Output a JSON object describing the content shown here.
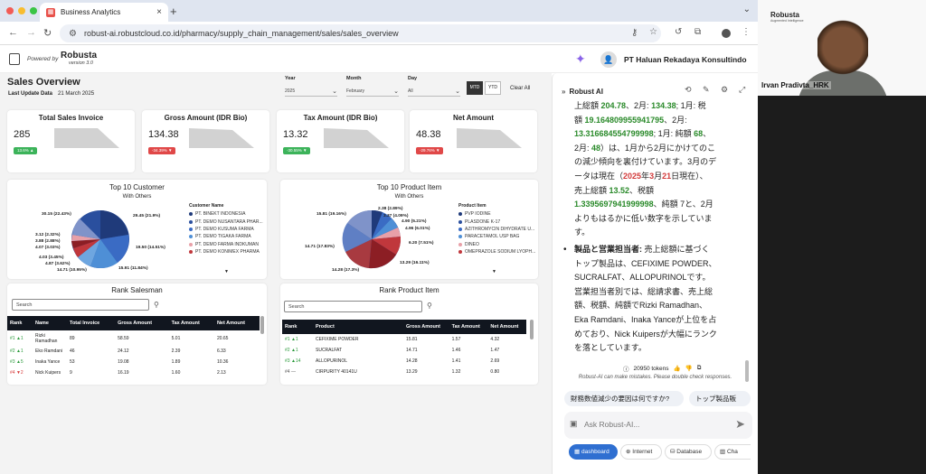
{
  "browser": {
    "tab_title": "Business Analytics",
    "url": "robust-ai.robustcloud.co.id/pharmacy/supply_chain_management/sales/sales_overview"
  },
  "header": {
    "powered_by": "Powered by",
    "logo": "Robusta",
    "version": "version 3.0",
    "company": "PT Haluan Rekadaya Konsultindo"
  },
  "page": {
    "title": "Sales Overview",
    "update_label": "Last Update Data",
    "update_value": "21 March 2025"
  },
  "filters": {
    "year_label": "Year",
    "year_value": "2025",
    "month_label": "Month",
    "month_value": "February",
    "day_label": "Day",
    "day_value": "All",
    "mtd": "MTD",
    "ytd": "YTD",
    "clear": "Clear All"
  },
  "kpis": [
    {
      "title": "Total Sales Invoice",
      "value": "285",
      "badge": "13.6% ▲",
      "badge_color": "#3cb35a"
    },
    {
      "title": "Gross Amount (IDR Bio)",
      "value": "134.38",
      "badge": "-34.39% ▼",
      "badge_color": "#e04848"
    },
    {
      "title": "Tax Amount (IDR Bio)",
      "value": "13.32",
      "badge": "-30.55% ▼",
      "badge_color": "#3cb35a"
    },
    {
      "title": "Net Amount",
      "value": "48.38",
      "badge": "-29.76% ▼",
      "badge_color": "#e04848"
    }
  ],
  "top_customer": {
    "title": "Top 10 Customer",
    "subtitle": "With Others",
    "legend_title": "Customer Name",
    "legend": [
      {
        "name": "PT. BINEKT INDONESIA",
        "color": "#1f3a7a"
      },
      {
        "name": "PT. DEMO NUSANTARA PHAR...",
        "color": "#2a4f9e"
      },
      {
        "name": "PT. DEMO KUSUMA FARMA",
        "color": "#3a6bc4"
      },
      {
        "name": "PT. DEMO TIGAKA FARMA",
        "color": "#4e8fd6"
      },
      {
        "name": "PT. DEMO FARMA INDKUMAN",
        "color": "#e8a0a8"
      },
      {
        "name": "PT. DEMO KONIMEX PHARMA",
        "color": "#c0373c"
      }
    ],
    "labels": [
      {
        "text": "30.15 (22.43%)"
      },
      {
        "text": "3.12 (2.32%)"
      },
      {
        "text": "3.88 (2.88%)"
      },
      {
        "text": "4.07 (3.03%)"
      },
      {
        "text": "4.03 (3.45%)"
      },
      {
        "text": "4.87 (3.62%)"
      },
      {
        "text": "14.71 (10.95%)"
      },
      {
        "text": "15.91 (11.84%)"
      },
      {
        "text": "19.50 (14.51%)"
      },
      {
        "text": "29.45 (21.9%)"
      }
    ]
  },
  "top_product": {
    "title": "Top 10 Product Item",
    "subtitle": "With Others",
    "legend_title": "Product Item",
    "legend": [
      {
        "name": "PVP IODINE",
        "color": "#1f3a7a"
      },
      {
        "name": "PLASDONE K-17",
        "color": "#2a4f9e"
      },
      {
        "name": "AZITHROMYCIN DIHYDRATE U...",
        "color": "#3a6bc4"
      },
      {
        "name": "PARACETAMOL USP BAG",
        "color": "#4e8fd6"
      },
      {
        "name": "DINEO",
        "color": "#e8a0a8"
      },
      {
        "name": "OMEPRAZOLE SODIUM LYOPH...",
        "color": "#c0373c"
      }
    ],
    "labels": [
      {
        "text": "15.81 (19.16%)"
      },
      {
        "text": "2.38 (2.89%)"
      },
      {
        "text": "3.37 (4.09%)"
      },
      {
        "text": "4.90 (5.21%)"
      },
      {
        "text": "4.96 (6.01%)"
      },
      {
        "text": "6.20 (7.51%)"
      },
      {
        "text": "13.29 (16.11%)"
      },
      {
        "text": "14.28 (17.3%)"
      },
      {
        "text": "14.71 (17.83%)"
      }
    ]
  },
  "rank_salesman": {
    "title": "Rank Salesman",
    "search_placeholder": "Search",
    "columns": [
      "Rank",
      "Name",
      "Total Invoice",
      "Gross Amount",
      "Tax Amount",
      "Net Amount"
    ],
    "rows": [
      {
        "rank": "#1",
        "arrow": "▲1",
        "dir": "up",
        "name": "Rizki Ramadhan",
        "inv": "89",
        "gross": "58.59",
        "tax": "5.01",
        "net": "20.65"
      },
      {
        "rank": "#2",
        "arrow": "▲1",
        "dir": "up",
        "name": "Eko Ramdani",
        "inv": "46",
        "gross": "24.12",
        "tax": "2.39",
        "net": "6.33"
      },
      {
        "rank": "#3",
        "arrow": "▲5",
        "dir": "up",
        "name": "Inaka Yance",
        "inv": "53",
        "gross": "19.08",
        "tax": "1.89",
        "net": "10.36"
      },
      {
        "rank": "#4",
        "arrow": "▼2",
        "dir": "dn",
        "name": "Nick Kuipers",
        "inv": "9",
        "gross": "16.19",
        "tax": "1.60",
        "net": "2.13"
      }
    ]
  },
  "rank_product": {
    "title": "Rank Product Item",
    "search_placeholder": "Search",
    "columns": [
      "Rank",
      "Product",
      "Gross Amount",
      "Tax Amount",
      "Net Amount"
    ],
    "rows": [
      {
        "rank": "#1",
        "arrow": "▲1",
        "dir": "up",
        "name": "CEFIXIME POWDER",
        "gross": "15.81",
        "tax": "1.57",
        "net": "4.32"
      },
      {
        "rank": "#2",
        "arrow": "▲1",
        "dir": "up",
        "name": "SUCRALFAT",
        "gross": "14.71",
        "tax": "1.46",
        "net": "1.47"
      },
      {
        "rank": "#3",
        "arrow": "▲14",
        "dir": "up",
        "name": "ALLOPURINOL",
        "gross": "14.28",
        "tax": "1.41",
        "net": "2.69"
      },
      {
        "rank": "#4",
        "arrow": "—",
        "dir": "gray",
        "name": "CIRPURITY 40141U",
        "gross": "13.29",
        "tax": "1.32",
        "net": "0.80"
      }
    ]
  },
  "ai": {
    "title": "Robust AI",
    "tokens": "20950 tokens",
    "disclaimer": "Robust-AI can make mistakes. Please double check responses.",
    "chips": [
      "財務数値減少の要因は何ですか?",
      "トップ製品販"
    ],
    "input_placeholder": "Ask Robust-AI...",
    "tools": [
      "dashboard",
      "Internet",
      "Database",
      "Cha"
    ],
    "msg": {
      "l1a": "上総額 ",
      "l1b": "204.78",
      "l1c": "、2月: ",
      "l1d": "134.38",
      "l1e": "; 1月: 税",
      "l2a": "額 ",
      "l2b": "19.164809955941795",
      "l2c": "、2月:",
      "l3a": "13.316684554799998",
      "l3b": "; 1月: 純額 ",
      "l3c": "68",
      "l3d": "、",
      "l4a": "2月: ",
      "l4b": "48",
      "l4c": "）は、1月から2月にかけてのこ",
      "l5": "の減少傾向を裏付けています。3月のデ",
      "l6a": "ータは現在（",
      "l6b": "2025",
      "l6c": "年",
      "l6d": "3",
      "l6e": "月",
      "l6f": "21",
      "l6g": "日現在）、",
      "l7a": "売上総額 ",
      "l7b": "13.52",
      "l7c": "、税額",
      "l8a": "1.3395697941999998",
      "l8b": "、純額 7と、2月",
      "l9": "よりもはるかに低い数字を示していま",
      "l10": "す。",
      "b1": "製品と営業担当者:",
      "b1b": " 売上総額に基づく",
      "l12": "トップ製品は、CEFIXIME POWDER、",
      "l13": "SUCRALFAT、ALLOPURINOLです。",
      "l14": "営業担当者別では、総請求書、売上総",
      "l15": "額、税額、純額でRizki Ramadhan、",
      "l16": "Eka Ramdani、Inaka Yanceが上位を占",
      "l17": "めており、Nick Kuipersが大幅にランク",
      "l18": "を落としています。"
    }
  },
  "video": {
    "logo": "Robusta",
    "sub": "Augmented Intelligence",
    "name": "Irvan Pradivta_HRK"
  }
}
